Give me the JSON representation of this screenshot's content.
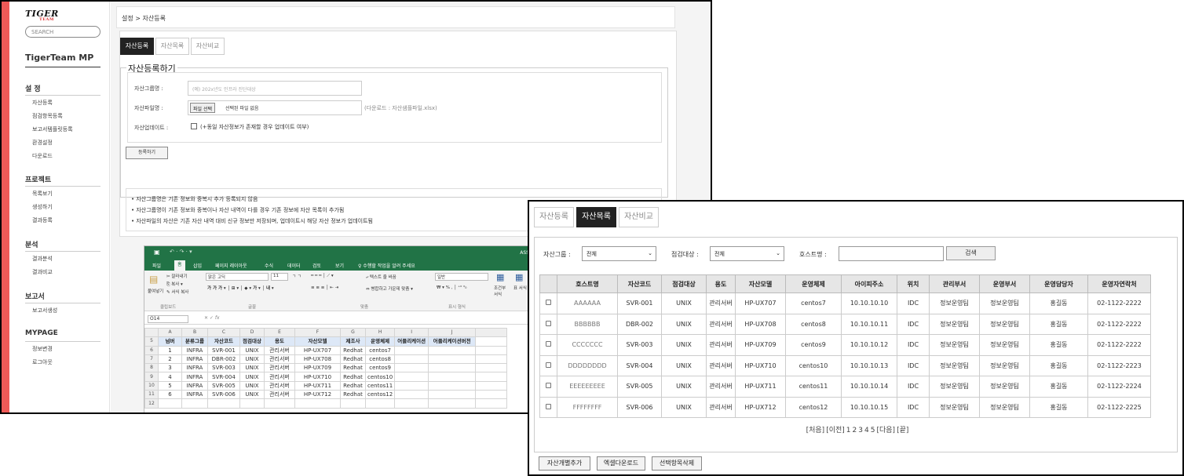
{
  "sidebar": {
    "logo": "TIGER",
    "logo_sub": "TEAM",
    "search_placeholder": "SEARCH",
    "title": "TigerTeam MP",
    "sections": [
      {
        "title": "설 정",
        "items": [
          "자산등록",
          "점검항목등록",
          "보고서템플릿등록",
          "환경설정",
          "다운로드"
        ]
      },
      {
        "title": "프로젝트",
        "items": [
          "목록보기",
          "생성하기",
          "결과등록"
        ]
      },
      {
        "title": "분석",
        "items": [
          "결과분석",
          "결과비교"
        ]
      },
      {
        "title": "보고서",
        "items": [
          "보고서생성"
        ]
      },
      {
        "title": "MYPAGE",
        "items": [
          "정보변경",
          "로그아웃"
        ]
      }
    ]
  },
  "main": {
    "breadcrumb": "설정 > 자산등록",
    "tabs": [
      "자산등록",
      "자산목록",
      "자산비교"
    ],
    "section_title": "자산등록하기",
    "form": {
      "group_label": "자산그룹명 :",
      "group_placeholder": "(예) 202x년도 인프라 진단대상",
      "file_label": "자산파일명 :",
      "file_button": "파일 선택",
      "file_status": "선택된 파일 없음",
      "file_hint": "(다운로드 : 자산샘플파일.xlsx)",
      "update_label": "자산업데이트 :",
      "update_text": "(+동일 자산정보가 존재할 경우 업데이트 여부)",
      "submit": "등록하기"
    },
    "notes": [
      "자산그룹명은 기존 정보와 중복시 추가 등록되지 않음",
      "자산그룹명이 기존 정보와 중복이나 자산 내역이 다를 경우 기존 정보에 자산 목록이 추가됨",
      "자산파일의 자산은 기존 자산 내역 대비 신규 정보만 저장되며, 업데이트시 해당 자산 정보가 업데이트됨"
    ]
  },
  "excel": {
    "menu_tabs": [
      "파일",
      "홈",
      "삽입",
      "페이지 레이아웃",
      "수식",
      "데이터",
      "검토",
      "보기"
    ],
    "tell_me": "♀ 수행할 작업을 알려 주세요",
    "account": "ASS",
    "ribbon": {
      "paste": "붙여넣기",
      "cut": "잘라내기",
      "copy": "복사",
      "format_painter": "서식 복사",
      "clipboard": "클립보드",
      "font_name": "맑은 고딕",
      "font_size": "11",
      "font_group": "글꼴",
      "wrap_text": "텍스트 줄 바꿈",
      "merge_center": "병합하고 가운데 맞춤",
      "align_group": "맞춤",
      "number_format": "일반",
      "number_group": "표시 형식",
      "conditional": "조건부 서식",
      "table": "표 서식"
    },
    "name_box": "O14",
    "fx": "fx",
    "columns": [
      "A",
      "B",
      "C",
      "D",
      "E",
      "F",
      "G",
      "H",
      "I",
      "J"
    ],
    "header_row_num": "5",
    "headers": [
      "넘버",
      "분류그룹",
      "자산코드",
      "점검대상",
      "용도",
      "자산모델",
      "제조사",
      "운영체제",
      "어플리케이션",
      "어플리케이션버전"
    ],
    "rows": [
      {
        "n": "6",
        "cells": [
          "1",
          "INFRA",
          "SVR-001",
          "UNIX",
          "관리서버",
          "HP-UX707",
          "Redhat",
          "centos7",
          "",
          ""
        ]
      },
      {
        "n": "7",
        "cells": [
          "2",
          "INFRA",
          "DBR-002",
          "UNIX",
          "관리서버",
          "HP-UX708",
          "Redhat",
          "centos8",
          "",
          ""
        ]
      },
      {
        "n": "8",
        "cells": [
          "3",
          "INFRA",
          "SVR-003",
          "UNIX",
          "관리서버",
          "HP-UX709",
          "Redhat",
          "centos9",
          "",
          ""
        ]
      },
      {
        "n": "9",
        "cells": [
          "4",
          "INFRA",
          "SVR-004",
          "UNIX",
          "관리서버",
          "HP-UX710",
          "Redhat",
          "centos10",
          "",
          ""
        ]
      },
      {
        "n": "10",
        "cells": [
          "5",
          "INFRA",
          "SVR-005",
          "UNIX",
          "관리서버",
          "HP-UX711",
          "Redhat",
          "centos11",
          "",
          ""
        ]
      },
      {
        "n": "11",
        "cells": [
          "6",
          "INFRA",
          "SVR-006",
          "UNIX",
          "관리서버",
          "HP-UX712",
          "Redhat",
          "centos12",
          "",
          ""
        ]
      },
      {
        "n": "12",
        "cells": [
          "",
          "",
          "",
          "",
          "",
          "",
          "",
          "",
          "",
          ""
        ]
      }
    ]
  },
  "list": {
    "tabs": [
      "자산등록",
      "자산목록",
      "자산비교"
    ],
    "filter": {
      "group_label": "자산그룹 :",
      "group_value": "전체",
      "target_label": "점검대상 :",
      "target_value": "전체",
      "host_label": "호스트명 :",
      "search": "검색"
    },
    "columns": [
      "",
      "호스트명",
      "자산코드",
      "점검대상",
      "용도",
      "자산모델",
      "운영체제",
      "아이피주소",
      "위치",
      "관리부서",
      "운영부서",
      "운영담당자",
      "운영자연락처"
    ],
    "rows": [
      [
        "AAAAAA",
        "SVR-001",
        "UNIX",
        "관리서버",
        "HP-UX707",
        "centos7",
        "10.10.10.10",
        "IDC",
        "정보운영팀",
        "정보운영팀",
        "홍길동",
        "02-1122-2222"
      ],
      [
        "BBBBBB",
        "DBR-002",
        "UNIX",
        "관리서버",
        "HP-UX708",
        "centos8",
        "10.10.10.11",
        "IDC",
        "정보운영팀",
        "정보운영팀",
        "홍길동",
        "02-1122-2222"
      ],
      [
        "CCCCCCC",
        "SVR-003",
        "UNIX",
        "관리서버",
        "HP-UX709",
        "centos9",
        "10.10.10.12",
        "IDC",
        "정보운영팀",
        "정보운영팀",
        "홍길동",
        "02-1122-2222"
      ],
      [
        "DDDDDDDD",
        "SVR-004",
        "UNIX",
        "관리서버",
        "HP-UX710",
        "centos10",
        "10.10.10.13",
        "IDC",
        "정보운영팀",
        "정보운영팀",
        "홍길동",
        "02-1122-2223"
      ],
      [
        "EEEEEEEEE",
        "SVR-005",
        "UNIX",
        "관리서버",
        "HP-UX711",
        "centos11",
        "10.10.10.14",
        "IDC",
        "정보운영팀",
        "정보운영팀",
        "홍길동",
        "02-1122-2224"
      ],
      [
        "FFFFFFFF",
        "SVR-006",
        "UNIX",
        "관리서버",
        "HP-UX712",
        "centos12",
        "10.10.10.15",
        "IDC",
        "정보운영팀",
        "정보운영팀",
        "홍길동",
        "02-1122-2225"
      ]
    ],
    "pager": [
      "[처음]",
      "[이전]",
      "1",
      "2",
      "3",
      "4",
      "5",
      "[다음]",
      "[끝]"
    ],
    "buttons": [
      "자산개별추가",
      "엑셀다운로드",
      "선택항목삭제"
    ]
  }
}
